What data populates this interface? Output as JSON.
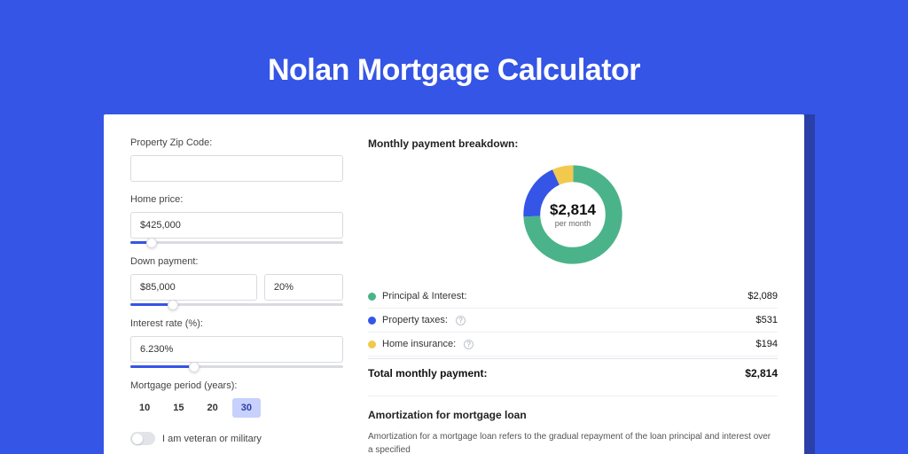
{
  "title": "Nolan Mortgage Calculator",
  "form": {
    "zip_label": "Property Zip Code:",
    "zip_value": "",
    "home_price_label": "Home price:",
    "home_price_value": "$425,000",
    "home_price_slider_pct": 10,
    "down_payment_label": "Down payment:",
    "down_payment_value": "$85,000",
    "down_payment_pct_value": "20%",
    "down_payment_slider_pct": 20,
    "interest_label": "Interest rate (%):",
    "interest_value": "6.230%",
    "interest_slider_pct": 30,
    "period_label": "Mortgage period (years):",
    "period_options": [
      "10",
      "15",
      "20",
      "30"
    ],
    "period_selected": "30",
    "veteran_label": "I am veteran or military"
  },
  "breakdown": {
    "title": "Monthly payment breakdown:",
    "center_amount": "$2,814",
    "center_sub": "per month",
    "items": [
      {
        "label": "Principal & Interest:",
        "value": "$2,089",
        "color": "#4bb38a",
        "help": false
      },
      {
        "label": "Property taxes:",
        "value": "$531",
        "color": "#3555e6",
        "help": true
      },
      {
        "label": "Home insurance:",
        "value": "$194",
        "color": "#f2c94c",
        "help": true
      }
    ],
    "total_label": "Total monthly payment:",
    "total_value": "$2,814"
  },
  "chart_data": {
    "type": "pie",
    "title": "Monthly payment breakdown",
    "series": [
      {
        "name": "Principal & Interest",
        "value": 2089,
        "color": "#4bb38a"
      },
      {
        "name": "Property taxes",
        "value": 531,
        "color": "#3555e6"
      },
      {
        "name": "Home insurance",
        "value": 194,
        "color": "#f2c94c"
      }
    ],
    "total": 2814
  },
  "amortization": {
    "title": "Amortization for mortgage loan",
    "text": "Amortization for a mortgage loan refers to the gradual repayment of the loan principal and interest over a specified"
  }
}
